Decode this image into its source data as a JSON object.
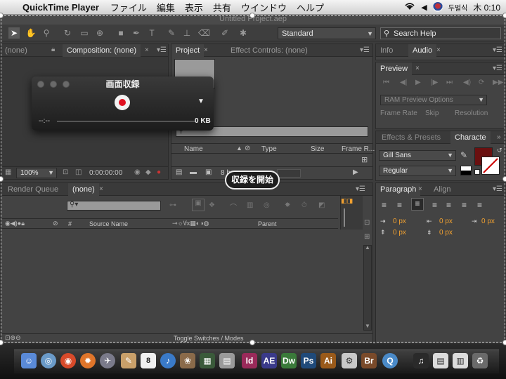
{
  "menubar": {
    "app_name": "QuickTime Player",
    "items": [
      "ファイル",
      "編集",
      "表示",
      "共有",
      "ウインドウ",
      "ヘルプ"
    ],
    "input_method": "두벌식",
    "clock": "木 0:10"
  },
  "ae": {
    "window_title": "Untitled Project.aep",
    "workspace": "Standard",
    "search_help": "Search Help",
    "comp_panel": {
      "left_tab": "(none)",
      "tab": "Composition: (none)",
      "zoom": "100%",
      "timecode": "0:00:00:00"
    },
    "project_panel": {
      "tabs": [
        "Project",
        "Effect Controls: (none)"
      ],
      "columns": [
        "Name",
        "Type",
        "Size",
        "Frame R..."
      ],
      "bpc": "8 bpc"
    },
    "right_top_tabs": [
      "Info",
      "Audio"
    ],
    "preview": {
      "tab": "Preview",
      "ram_options": "RAM Preview Options",
      "labels": [
        "Frame Rate",
        "Skip",
        "Resolution"
      ]
    },
    "effects_tabs": [
      "Effects & Presets",
      "Characte"
    ],
    "character": {
      "font": "Gill Sans",
      "style": "Regular"
    },
    "paragraph": {
      "tabs": [
        "Paragraph",
        "Align"
      ],
      "values": [
        "0 px",
        "0 px",
        "0 px",
        "0 px",
        "0 px"
      ]
    },
    "timeline": {
      "tabs": [
        "Render Queue",
        "(none)"
      ],
      "columns": [
        "#",
        "Source Name",
        "Parent"
      ],
      "toggle": "Toggle Switches / Modes"
    }
  },
  "quicktime": {
    "title": "画面収録",
    "time": "--:--",
    "size": "0 KB",
    "start_button": "収録を開始"
  },
  "dock": {
    "labels": [
      "Id",
      "AE",
      "Dw",
      "Ps",
      "Ai",
      "Br"
    ],
    "calendar_day": "8",
    "colors": [
      "#9a2a5a",
      "#3a3a8a",
      "#3a7a3a",
      "#1f4a7a",
      "#9a5a1a",
      "#7a4a2a"
    ]
  }
}
